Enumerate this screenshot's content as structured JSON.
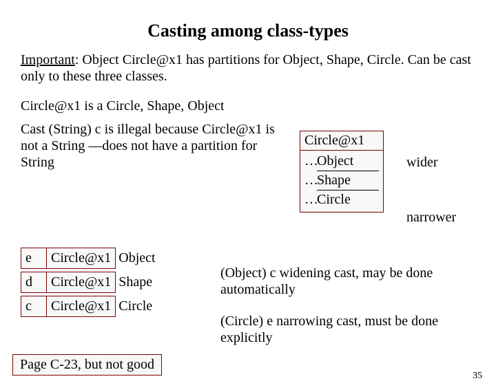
{
  "title": "Casting among class-types",
  "para1_lead": "Important",
  "para1_rest": ": Object Circle@x1 has partitions for Object, Shape, Circle. Can be cast only to these three classes.",
  "isa_line": "Circle@x1   is a  Circle, Shape, Object",
  "part_header": "Circle@x1",
  "part_rows": [
    {
      "dots": "…",
      "cls": "Object"
    },
    {
      "dots": "…",
      "cls": "Shape"
    },
    {
      "dots": "…",
      "cls": "Circle"
    }
  ],
  "wider": "wider",
  "narrower": "narrower",
  "txt2": "Cast (String) c  is illegal because Circle@x1 is not a String —does not have a partition for String",
  "vars": [
    {
      "name": "e",
      "val": "Circle@x1",
      "type": "Object"
    },
    {
      "name": "d",
      "val": "Circle@x1",
      "type": "Shape"
    },
    {
      "name": "c",
      "val": "Circle@x1",
      "type": "Circle"
    }
  ],
  "footnote": "Page C-23, but not good",
  "right1": "(Object) c  widening cast, may be done automatically",
  "right2": "(Circle) e   narrowing cast, must be done explicitly",
  "pagenum": "35"
}
